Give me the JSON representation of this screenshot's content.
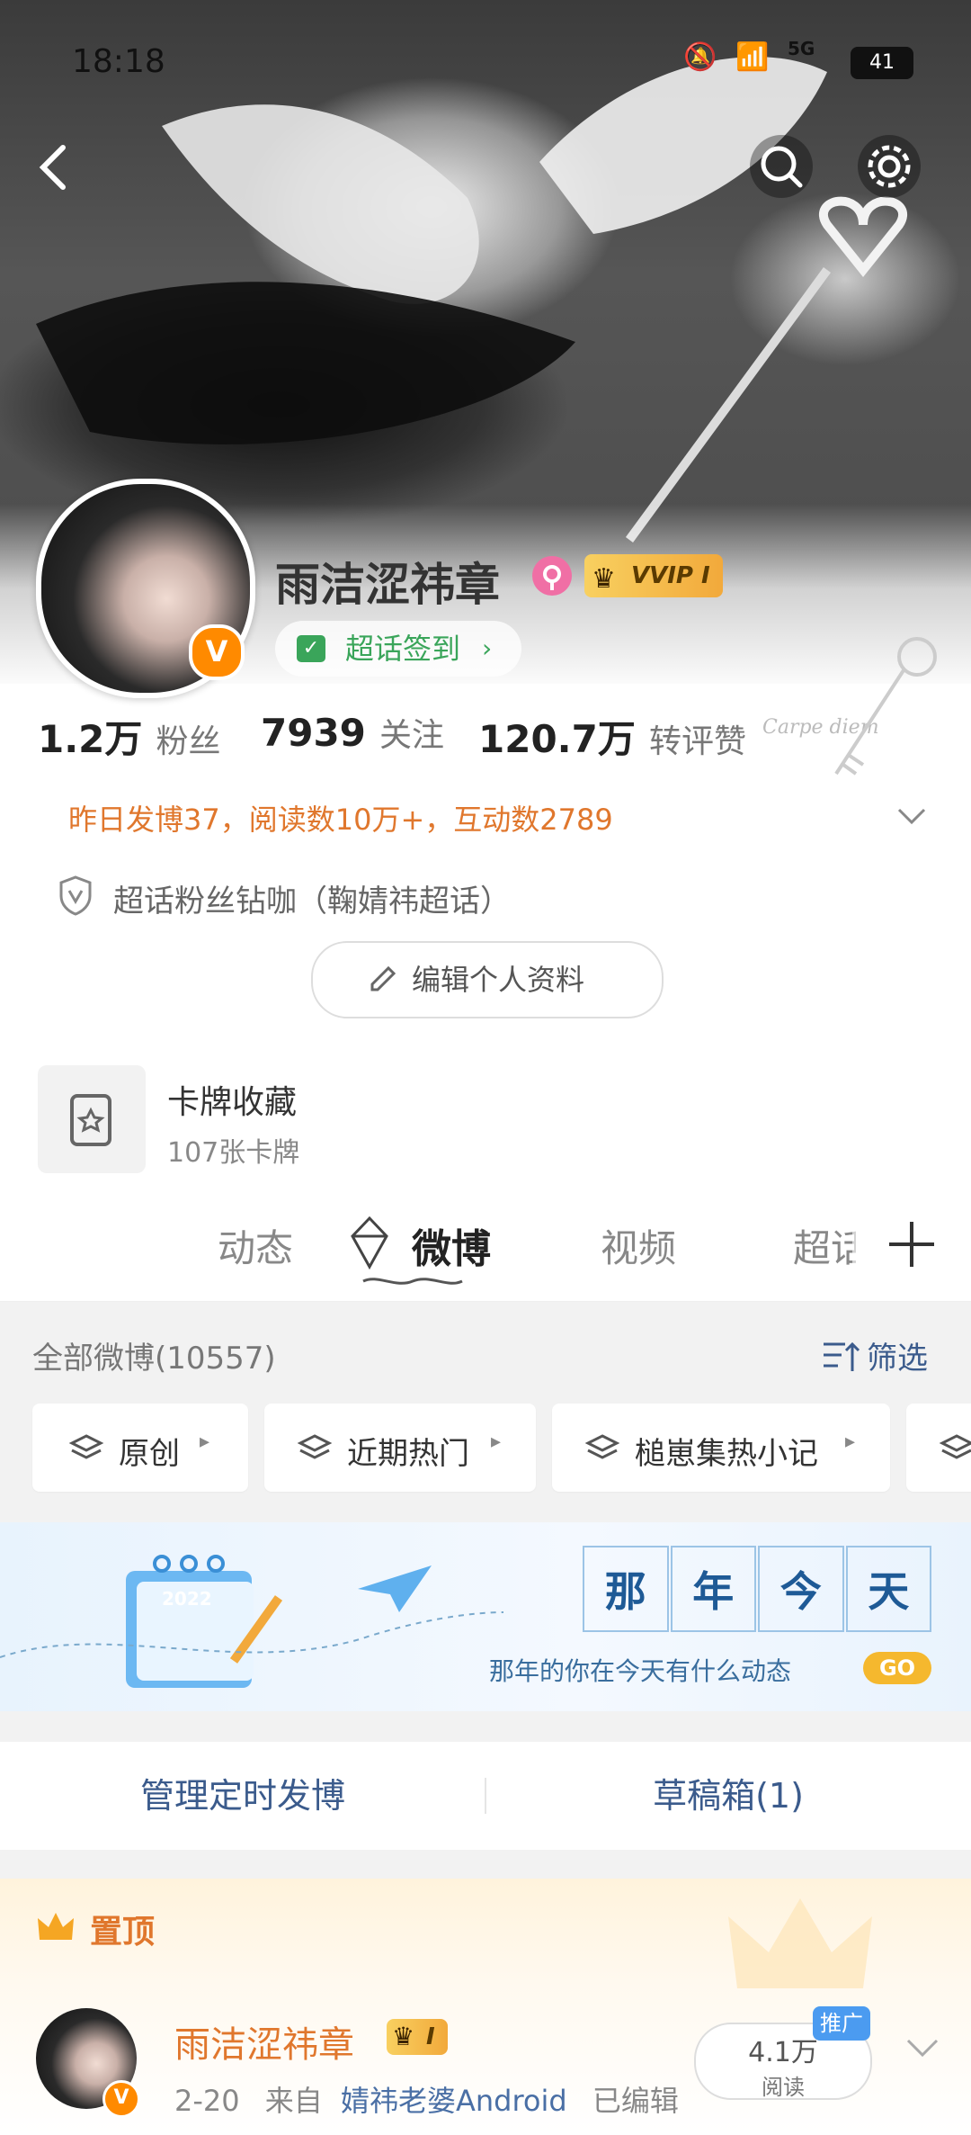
{
  "status_bar": {
    "time": "18:18",
    "network": "5G",
    "battery": "41"
  },
  "profile": {
    "name": "雨洁涩祎章",
    "vip_label": "VVIP I",
    "super_topic_checkin": "超话签到",
    "stats": [
      {
        "value": "1.2万",
        "label": "粉丝"
      },
      {
        "value": "7939",
        "label": "关注"
      },
      {
        "value": "120.7万",
        "label": "转评赞"
      }
    ],
    "activity_summary": "昨日发博37，阅读数10万+，互动数2789",
    "fan_badge": "超话粉丝钻咖（鞠婧祎超话）",
    "edit_button": "编辑个人资料",
    "signature_text": "Carpe diem"
  },
  "card_collection": {
    "title": "卡牌收藏",
    "subtitle": "107张卡牌"
  },
  "tabs": [
    {
      "label": "动态"
    },
    {
      "label": "微博"
    },
    {
      "label": "视频"
    },
    {
      "label": "超话"
    }
  ],
  "feed_header": {
    "title": "全部微博(10557)",
    "filter_label": "筛选"
  },
  "chips": [
    {
      "label": "原创"
    },
    {
      "label": "近期热门"
    },
    {
      "label": "槌崽集热小记"
    }
  ],
  "banner": {
    "characters": [
      "那",
      "年",
      "今",
      "天"
    ],
    "subtitle": "那年的你在今天有什么动态",
    "go_label": "GO",
    "calendar_year": "2022"
  },
  "actions": {
    "scheduled": "管理定时发博",
    "drafts": "草稿箱(1)"
  },
  "pinned": {
    "label": "置顶",
    "author": "雨洁涩祎章",
    "vip_level": "I",
    "date": "2-20",
    "source_prefix": "来自",
    "source": "婧祎老婆Android",
    "edited": "已编辑",
    "reads_value": "4.1万",
    "reads_label": "阅读",
    "promo_tag": "推广"
  },
  "colors": {
    "accent_orange": "#e0772d",
    "super_topic_green": "#3aa55a",
    "vip_gold": "#f5b83d",
    "link_blue": "#4a6fa5"
  }
}
